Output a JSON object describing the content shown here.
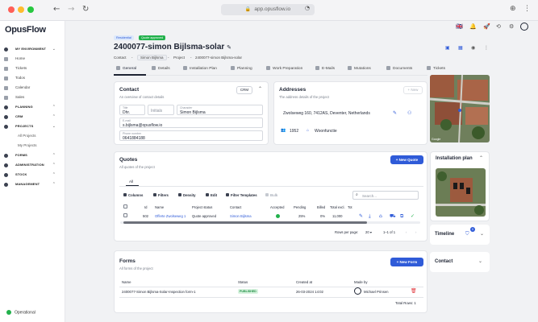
{
  "browser": {
    "url": "app.opusflow.io"
  },
  "app": {
    "logo": "OpusFlow"
  },
  "sidebar": {
    "items": [
      {
        "label": "MY ENVIRONMENT",
        "group": true
      },
      {
        "label": "Home"
      },
      {
        "label": "Tickets"
      },
      {
        "label": "Todos"
      },
      {
        "label": "Calendar"
      },
      {
        "label": "Sales"
      },
      {
        "label": "PLANNING",
        "group": true
      },
      {
        "label": "CRM",
        "group": true
      },
      {
        "label": "PROJECTS",
        "group": true
      },
      {
        "label": "All Projects",
        "sub": true
      },
      {
        "label": "My Projects",
        "sub": true
      },
      {
        "label": "FORMS",
        "group": true
      },
      {
        "label": "ADMINISTRATION",
        "group": true
      },
      {
        "label": "STOCK",
        "group": true
      },
      {
        "label": "MANAGEMENT",
        "group": true
      }
    ],
    "status": "Operational"
  },
  "project": {
    "badge_type": "Residential",
    "badge_status": "Quote approved",
    "title": "2400077-simon Bijlsma-solar",
    "crumb_contact": "Contact",
    "crumb_sep1": "-",
    "crumb_name": "Simon Bijlsma",
    "crumb_sep2": "-",
    "crumb_project": "Project",
    "crumb_sep3": "-",
    "crumb_project_name": "2400077-simon Bijlsma-solar"
  },
  "tabs": [
    "General",
    "Details",
    "Installation Plan",
    "Planning",
    "Work Preparation",
    "E-Mails",
    "Mutations",
    "Documents",
    "Tickets"
  ],
  "contact": {
    "title": "Contact",
    "subtitle": "An overview of contact details",
    "crm_button": "CRM",
    "title_label": "Title",
    "title_value": "Dhr.",
    "initials_placeholder": "Initials",
    "character_label": "Character",
    "character_value": "Simon Bijlsma",
    "email_label": "E-mail",
    "email_value": "s.bijlsma@opusflow.io",
    "phone_label": "Phone number",
    "phone_value": "0641884188"
  },
  "addresses": {
    "title": "Addresses",
    "subtitle": "The address details of the project",
    "new_button": "+ New",
    "address": "Zwolseweg 160, 7412AS, Deventer, Netherlands",
    "year": "1952",
    "type": "Woonfunctie"
  },
  "quotes": {
    "title": "Quotes",
    "subtitle": "All quotes of the project",
    "new_button": "+ New Quote",
    "tab_all": "All",
    "toolbar": [
      "Columns",
      "Filters",
      "Density",
      "Edit",
      "Filter Templates",
      "Bulk"
    ],
    "search_placeholder": "Search...",
    "columns": [
      "Id",
      "Name",
      "Project status",
      "Contact",
      "Accepted",
      "Pending",
      "Billed",
      "Total excl.",
      "Tot"
    ],
    "rows": [
      {
        "id": "502",
        "name": "Offerte Zwolseweg 1",
        "status": "Quote approved",
        "contact": "Simon Bijlsma",
        "pending": "25%",
        "billed": "0%",
        "total": "11,000"
      }
    ],
    "rows_per_page_label": "Rows per page:",
    "rows_per_page": "20",
    "range": "1–1 of 1"
  },
  "forms": {
    "title": "Forms",
    "subtitle": "All forms of the project",
    "new_button": "+ New Form",
    "columns": [
      "Name",
      "Status",
      "Created at",
      "Made by"
    ],
    "rows": [
      {
        "name": "2400077-Simon Bijlsma-Solar-Inspection form-1",
        "status": "PUBLISHED",
        "created": "26-03-2024 14:02",
        "made_by": "Michael Prinsen"
      }
    ],
    "total": "Total Rows: 1"
  },
  "side": {
    "map_caption": "Google",
    "installation_plan": "Installation plan",
    "timeline": "Timeline",
    "timeline_count": "0",
    "contact": "Contact"
  }
}
